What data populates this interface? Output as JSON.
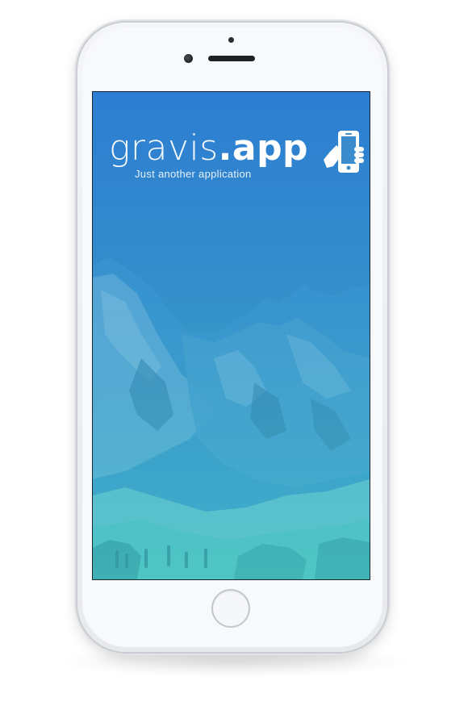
{
  "app": {
    "name_light": "gravis",
    "name_bold": ".app",
    "tagline": "Just another application",
    "logo_icon": "hand-holding-phone-icon"
  },
  "colors": {
    "screen_top": "#2f7fd0",
    "screen_bottom": "#46c2c6",
    "logo_text": "#ffffff"
  }
}
